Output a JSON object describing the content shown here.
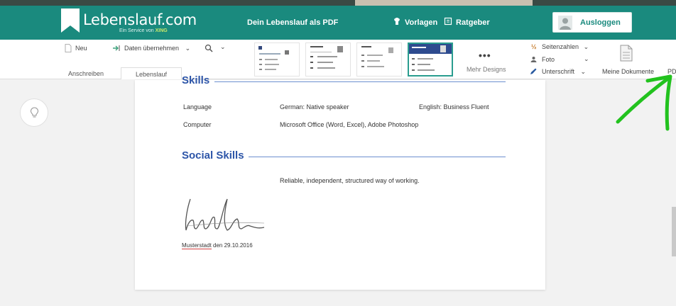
{
  "brand": {
    "title": "Lebenslauf.com",
    "subtitle_prefix": "Ein Service von",
    "subtitle_brand": "XING",
    "accent": "#1a8a7e"
  },
  "nav": {
    "pdf_label": "Dein Lebenslauf als PDF",
    "templates_label": "Vorlagen",
    "guide_label": "Ratgeber",
    "logout_label": "Ausloggen"
  },
  "toolbar": {
    "new_label": "Neu",
    "import_label": "Daten übernehmen",
    "more_designs_label": "Mehr Designs",
    "page_numbers_label": "Seitenzahlen",
    "photo_label": "Foto",
    "signature_label": "Unterschrift",
    "my_documents_label": "Meine Dokumente",
    "pdf_cut_label": "PDF"
  },
  "tabs": [
    {
      "label": "Anschreiben",
      "active": false
    },
    {
      "label": "Lebenslauf",
      "active": true
    }
  ],
  "document": {
    "skills_title": "Skills",
    "language_label": "Language",
    "language_value_1": "German: Native speaker",
    "language_value_2": "English: Business Fluent",
    "computer_label": "Computer",
    "computer_value": "Microsoft Office (Word, Excel), Adobe Photoshop",
    "social_title": "Social Skills",
    "social_value": "Reliable, independent, structured way of working.",
    "place": "Musterstadt",
    "date_text": "den 29.10.2016"
  },
  "icons": {
    "new": "document-icon",
    "import": "import-icon",
    "zoom": "zoom-icon",
    "page_numbers": "page-numbers-icon",
    "photo": "photo-icon",
    "signature": "pen-icon",
    "documents": "documents-icon",
    "templates": "shirt-icon",
    "guide": "book-icon",
    "hint": "lightbulb-icon"
  }
}
